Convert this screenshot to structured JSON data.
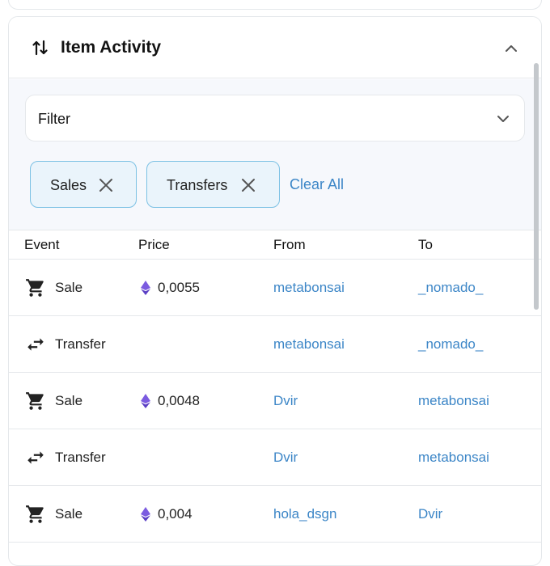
{
  "panel": {
    "title": "Item Activity",
    "icon": "arrows-up-down-icon",
    "collapse_icon": "chevron-up-icon"
  },
  "filter": {
    "label": "Filter",
    "icon": "chevron-down-icon"
  },
  "chips": [
    {
      "label": "Sales",
      "icon": "close-icon"
    },
    {
      "label": "Transfers",
      "icon": "close-icon"
    }
  ],
  "clear_all": "Clear All",
  "table": {
    "headers": [
      "Event",
      "Price",
      "From",
      "To"
    ],
    "rows": [
      {
        "event": "Sale",
        "icon": "cart-icon",
        "price": "0,0055",
        "from": "metabonsai",
        "to": "_nomado_"
      },
      {
        "event": "Transfer",
        "icon": "transfer-icon",
        "price": "",
        "from": "metabonsai",
        "to": "_nomado_"
      },
      {
        "event": "Sale",
        "icon": "cart-icon",
        "price": "0,0048",
        "from": "Dvir",
        "to": "metabonsai"
      },
      {
        "event": "Transfer",
        "icon": "transfer-icon",
        "price": "",
        "from": "Dvir",
        "to": "metabonsai"
      },
      {
        "event": "Sale",
        "icon": "cart-icon",
        "price": "0,004",
        "from": "hola_dsgn",
        "to": "Dvir"
      }
    ]
  },
  "colors": {
    "link": "#3c86c7",
    "chip_bg": "#eaf4fb",
    "chip_border": "#7cc1e4",
    "eth": "#6c4fd3",
    "filter_bg": "#f6f8fc"
  }
}
